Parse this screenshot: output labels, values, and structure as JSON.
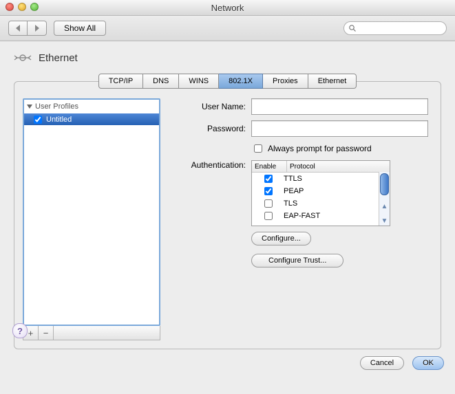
{
  "window_title": "Network",
  "toolbar": {
    "show_all": "Show All",
    "search_placeholder": ""
  },
  "pane_title": "Ethernet",
  "tabs": [
    "TCP/IP",
    "DNS",
    "WINS",
    "802.1X",
    "Proxies",
    "Ethernet"
  ],
  "selected_tab": "802.1X",
  "profiles": {
    "header": "User Profiles",
    "items": [
      {
        "checked": true,
        "name": "Untitled"
      }
    ]
  },
  "form": {
    "username_label": "User Name:",
    "username_value": "",
    "password_label": "Password:",
    "password_value": "",
    "always_prompt_label": "Always prompt for password",
    "always_prompt_checked": false,
    "auth_label": "Authentication:",
    "col_enable": "Enable",
    "col_protocol": "Protocol",
    "protocols": [
      {
        "enabled": true,
        "name": "TTLS"
      },
      {
        "enabled": true,
        "name": "PEAP"
      },
      {
        "enabled": false,
        "name": "TLS"
      },
      {
        "enabled": false,
        "name": "EAP-FAST"
      }
    ],
    "configure_btn": "Configure...",
    "configure_trust_btn": "Configure Trust..."
  },
  "footer": {
    "cancel": "Cancel",
    "ok": "OK"
  }
}
